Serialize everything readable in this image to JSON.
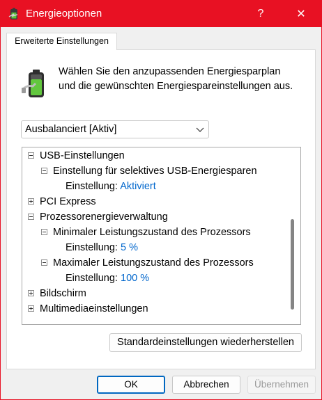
{
  "window": {
    "title": "Energieoptionen",
    "help_glyph": "?",
    "close_glyph": "✕"
  },
  "tab": {
    "label": "Erweiterte Einstellungen"
  },
  "description": "Wählen Sie den anzupassenden Energiesparplan und die gewünschten Energiespareinstellungen aus.",
  "plan_select": {
    "value": "Ausbalanciert [Aktiv]"
  },
  "tree": {
    "usb": "USB-Einstellungen",
    "usb_selective": "Einstellung für selektives USB-Energiesparen",
    "usb_setting_label": "Einstellung:",
    "usb_setting_value": "Aktiviert",
    "pci": "PCI Express",
    "cpu": "Prozessorenergieverwaltung",
    "cpu_min": "Minimaler Leistungszustand des Prozessors",
    "cpu_min_label": "Einstellung:",
    "cpu_min_value": "5 %",
    "cpu_max": "Maximaler Leistungszustand des Prozessors",
    "cpu_max_label": "Einstellung:",
    "cpu_max_value": "100 %",
    "display": "Bildschirm",
    "multimedia": "Multimediaeinstellungen"
  },
  "buttons": {
    "restore": "Standardeinstellungen wiederherstellen",
    "ok": "OK",
    "cancel": "Abbrechen",
    "apply": "Übernehmen"
  },
  "colors": {
    "titlebar": "#e81123",
    "link": "#0066cc",
    "ok_border": "#0067c0"
  }
}
